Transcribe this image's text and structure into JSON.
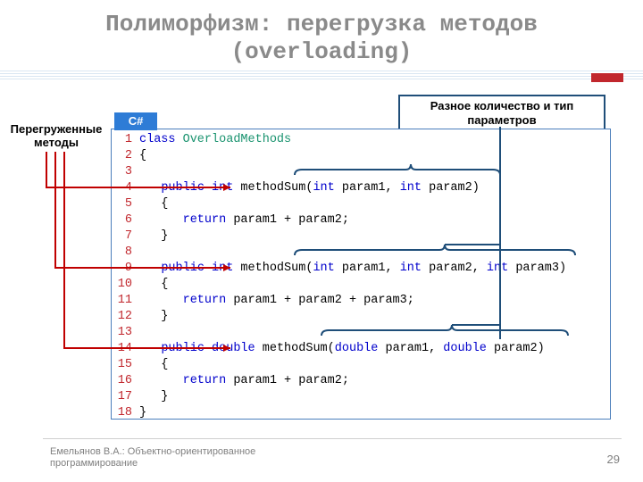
{
  "title_line1": "Полиморфизм: перегрузка методов",
  "title_line2": "(overloading)",
  "left_label": "Перегруженные методы",
  "callout": "Разное количество и тип параметров",
  "code_header": "C#",
  "code": {
    "lines": [
      {
        "n": "1",
        "tokens": [
          [
            "kw",
            "class "
          ],
          [
            "cls",
            "OverloadMethods"
          ]
        ]
      },
      {
        "n": "2",
        "tokens": [
          [
            "txt",
            "{"
          ]
        ]
      },
      {
        "n": "3",
        "tokens": []
      },
      {
        "n": "4",
        "tokens": [
          [
            "txt",
            "   "
          ],
          [
            "kw",
            "public int"
          ],
          [
            "txt",
            " methodSum("
          ],
          [
            "kw",
            "int"
          ],
          [
            "txt",
            " param1, "
          ],
          [
            "kw",
            "int"
          ],
          [
            "txt",
            " param2)"
          ]
        ]
      },
      {
        "n": "5",
        "tokens": [
          [
            "txt",
            "   {"
          ]
        ]
      },
      {
        "n": "6",
        "tokens": [
          [
            "txt",
            "      "
          ],
          [
            "kw",
            "return"
          ],
          [
            "txt",
            " param1 + param2;"
          ]
        ]
      },
      {
        "n": "7",
        "tokens": [
          [
            "txt",
            "   }"
          ]
        ]
      },
      {
        "n": "8",
        "tokens": []
      },
      {
        "n": "9",
        "tokens": [
          [
            "txt",
            "   "
          ],
          [
            "kw",
            "public int"
          ],
          [
            "txt",
            " methodSum("
          ],
          [
            "kw",
            "int"
          ],
          [
            "txt",
            " param1, "
          ],
          [
            "kw",
            "int"
          ],
          [
            "txt",
            " param2, "
          ],
          [
            "kw",
            "int"
          ],
          [
            "txt",
            " param3)"
          ]
        ]
      },
      {
        "n": "10",
        "tokens": [
          [
            "txt",
            "   {"
          ]
        ]
      },
      {
        "n": "11",
        "tokens": [
          [
            "txt",
            "      "
          ],
          [
            "kw",
            "return"
          ],
          [
            "txt",
            " param1 + param2 + param3;"
          ]
        ]
      },
      {
        "n": "12",
        "tokens": [
          [
            "txt",
            "   }"
          ]
        ]
      },
      {
        "n": "13",
        "tokens": []
      },
      {
        "n": "14",
        "tokens": [
          [
            "txt",
            "   "
          ],
          [
            "kw",
            "public double"
          ],
          [
            "txt",
            " methodSum("
          ],
          [
            "kw",
            "double"
          ],
          [
            "txt",
            " param1, "
          ],
          [
            "kw",
            "double"
          ],
          [
            "txt",
            " param2)"
          ]
        ]
      },
      {
        "n": "15",
        "tokens": [
          [
            "txt",
            "   {"
          ]
        ]
      },
      {
        "n": "16",
        "tokens": [
          [
            "txt",
            "      "
          ],
          [
            "kw",
            "return"
          ],
          [
            "txt",
            " param1 + param2;"
          ]
        ]
      },
      {
        "n": "17",
        "tokens": [
          [
            "txt",
            "   }"
          ]
        ]
      },
      {
        "n": "18",
        "tokens": [
          [
            "txt",
            "}"
          ]
        ]
      }
    ]
  },
  "footer_line1": "Емельянов В.А.: Объектно-ориентированное",
  "footer_line2": "программирование",
  "page_number": "29",
  "colors": {
    "accent_blue": "#2e7cd6",
    "connector": "#c00000",
    "brace": "#1f4e79"
  }
}
